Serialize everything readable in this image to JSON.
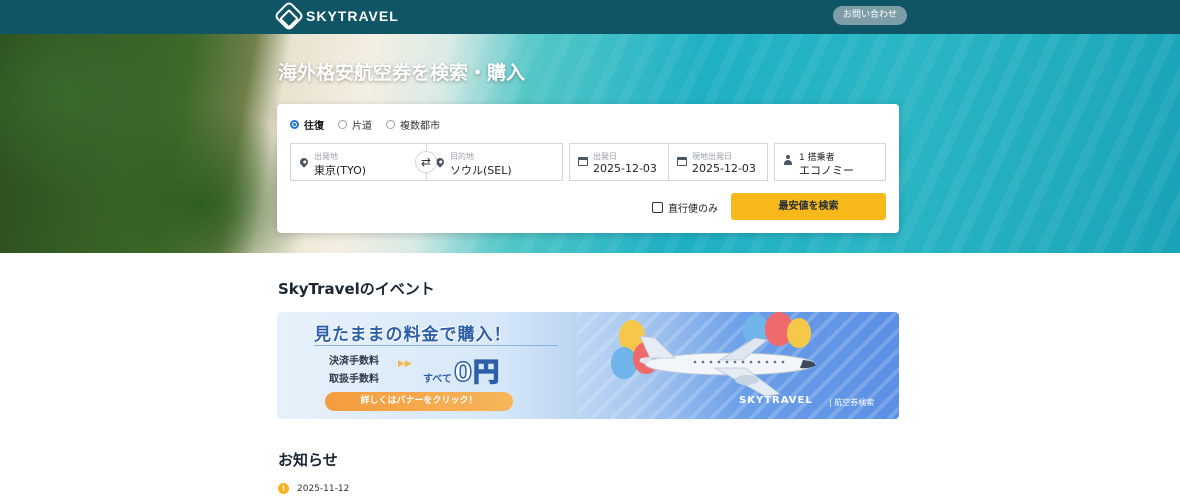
{
  "header": {
    "brand": "SKYTRAVEL",
    "contact_label": "お問い合わせ"
  },
  "hero": {
    "title": "海外格安航空券を検索・購入"
  },
  "search": {
    "trip_types": [
      {
        "label": "往復",
        "selected": true
      },
      {
        "label": "片道",
        "selected": false
      },
      {
        "label": "複数都市",
        "selected": false
      }
    ],
    "origin": {
      "label": "出発地",
      "value": "東京(TYO)"
    },
    "destination": {
      "label": "目的地",
      "value": "ソウル(SEL)"
    },
    "departure": {
      "label": "出発日",
      "value": "2025-12-03"
    },
    "return": {
      "label": "現地出発日",
      "value": "2025-12-03"
    },
    "passengers": {
      "label": "1 搭乗者",
      "value": "エコノミー"
    },
    "direct_only_label": "直行便のみ",
    "direct_only_checked": false,
    "submit_label": "最安値を検索"
  },
  "events": {
    "title": "SkyTravelのイベント",
    "banner": {
      "headline": "見たままの料金で購入！",
      "fee1": "決済手数料",
      "fee2": "取扱手数料",
      "all": "すべて",
      "amount": "0円",
      "cta": "詳しくはバナーをクリック！",
      "brand": "SKYTRAVEL",
      "brand_sub": "| 航空券検索"
    }
  },
  "news": {
    "title": "お知らせ",
    "items": [
      {
        "date": "2025-11-12",
        "icon": "!"
      }
    ]
  },
  "colors": {
    "header_bg": "#0f5566",
    "accent_button": "#f7b81b",
    "radio_active": "#1e73d8"
  }
}
